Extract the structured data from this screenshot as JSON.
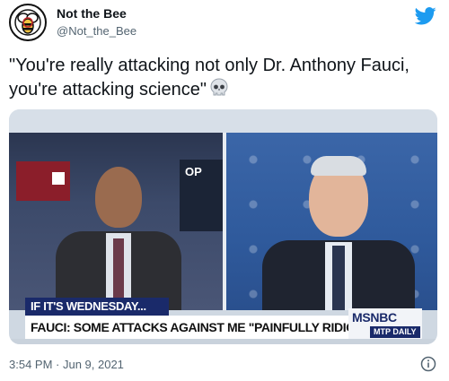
{
  "author": {
    "display_name": "Not the Bee",
    "handle": "@Not_the_Bee"
  },
  "tweet": {
    "text": "\"You're really attacking not only Dr. Anthony Fauci, you're attacking science\"",
    "emoji_icon": "skull-icon"
  },
  "media": {
    "lower_third_top": "IF IT'S WEDNESDAY...",
    "lower_third_main": "FAUCI: SOME ATTACKS AGAINST ME \"PAINFULLY RIDICULOUS\"",
    "network_logo": "MSNBC",
    "show_label": "MTP DAILY",
    "studio_screen_text": "OP"
  },
  "footer": {
    "timestamp": "3:54 PM · Jun 9, 2021"
  },
  "colors": {
    "twitter_blue": "#1d9bf0",
    "text_secondary": "#536471",
    "msnbc_navy": "#1a2a6a"
  }
}
